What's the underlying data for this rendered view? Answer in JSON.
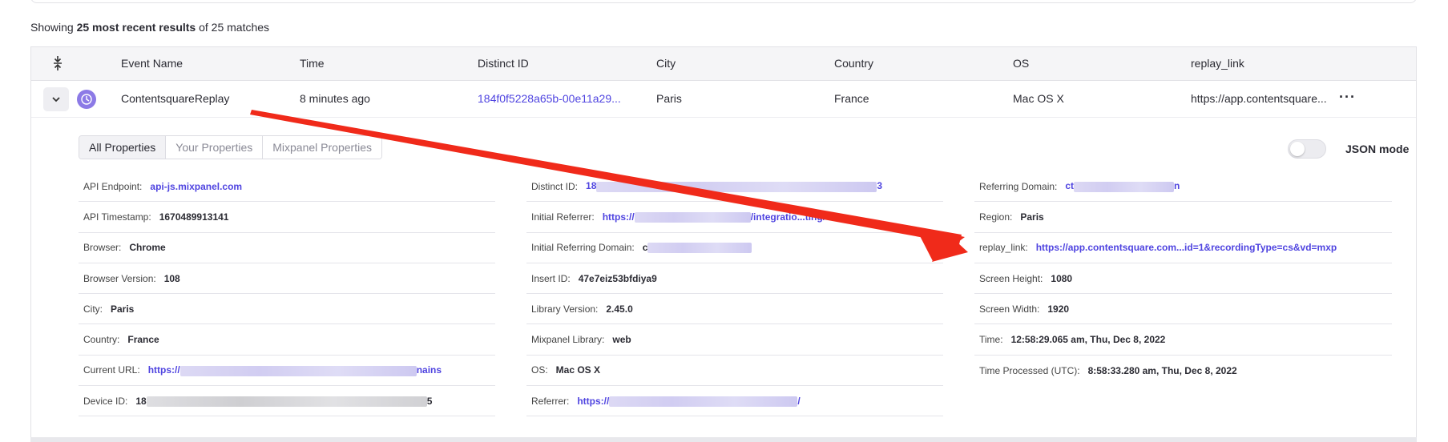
{
  "summary": {
    "prefix": "Showing ",
    "bold": "25 most recent results",
    "suffix": " of 25 matches"
  },
  "columns": [
    "Event Name",
    "Time",
    "Distinct ID",
    "City",
    "Country",
    "OS",
    "replay_link"
  ],
  "row": {
    "event_name": "ContentsquareReplay",
    "time": "8 minutes ago",
    "distinct_id": "184f0f5228a65b-00e11a29...",
    "city": "Paris",
    "country": "France",
    "os": "Mac OS X",
    "replay_link": "https://app.contentsquare..."
  },
  "tabs": [
    "All Properties",
    "Your Properties",
    "Mixpanel Properties"
  ],
  "json_mode_label": "JSON mode",
  "props": {
    "col1": [
      {
        "key": "API Endpoint:",
        "value": "api-js.mixpanel.com"
      },
      {
        "key": "API Timestamp:",
        "value": "1670489913141"
      },
      {
        "key": "Browser:",
        "value": "Chrome"
      },
      {
        "key": "Browser Version:",
        "value": "108"
      },
      {
        "key": "City:",
        "value": "Paris"
      },
      {
        "key": "Country:",
        "value": "France"
      },
      {
        "key": "Current URL:",
        "value": "https://",
        "tail": "nains"
      },
      {
        "key": "Device ID:",
        "value": "18",
        "tail": "5"
      }
    ],
    "col2": [
      {
        "key": "Distinct ID:",
        "value": "18",
        "tail": "3"
      },
      {
        "key": "Initial Referrer:",
        "value": "https://",
        "tail": "/integratio...ting/"
      },
      {
        "key": "Initial Referring Domain:",
        "value": "c"
      },
      {
        "key": "Insert ID:",
        "value": "47e7eiz53bfdiya9"
      },
      {
        "key": "Library Version:",
        "value": "2.45.0"
      },
      {
        "key": "Mixpanel Library:",
        "value": "web"
      },
      {
        "key": "OS:",
        "value": "Mac OS X"
      },
      {
        "key": "Referrer:",
        "value": "https://",
        "tail": "/"
      }
    ],
    "col3": [
      {
        "key": "Referring Domain:",
        "value": "ct",
        "tail": "n"
      },
      {
        "key": "Region:",
        "value": "Paris"
      },
      {
        "key": "replay_link:",
        "value": "https://app.contentsquare.com...id=1&recordingType=cs&vd=mxp"
      },
      {
        "key": "Screen Height:",
        "value": "1080"
      },
      {
        "key": "Screen Width:",
        "value": "1920"
      },
      {
        "key": "Time:",
        "value": "12:58:29.065 am, Thu, Dec 8, 2022"
      },
      {
        "key": "Time Processed (UTC):",
        "value": "8:58:33.280 am, Thu, Dec 8, 2022"
      }
    ]
  },
  "colors": {
    "link": "#4f44e0",
    "arrow": "#f02a1a",
    "event_icon": "#8c7ae6"
  }
}
